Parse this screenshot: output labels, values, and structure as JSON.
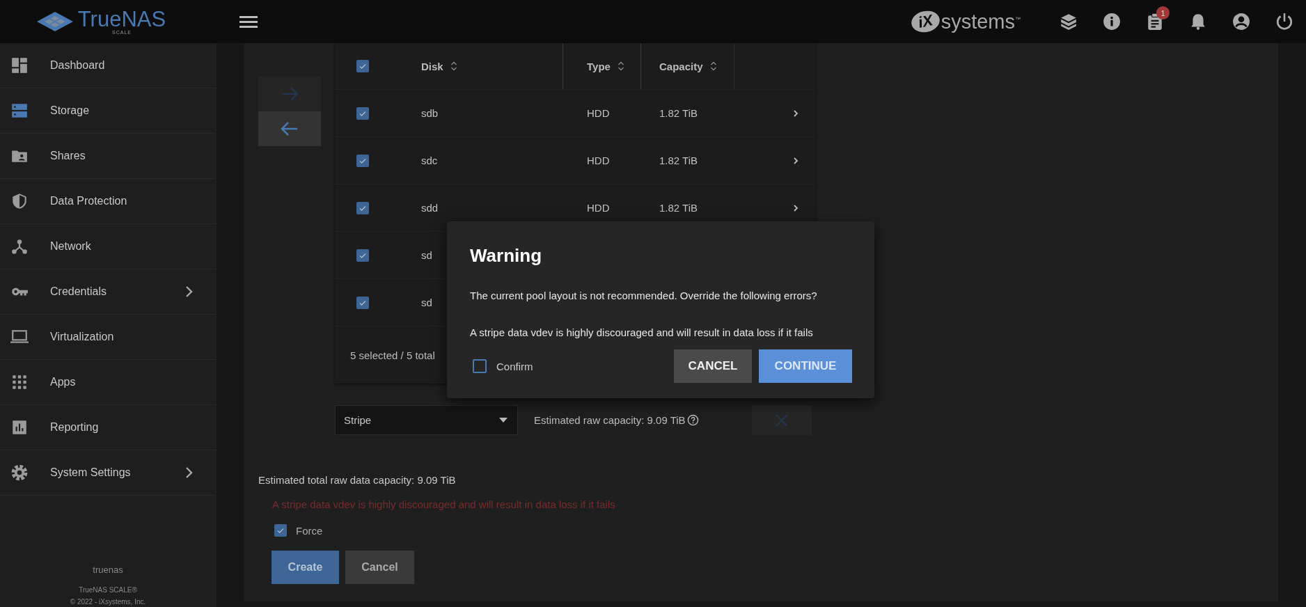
{
  "topbar": {
    "brand": {
      "name": "TrueNAS",
      "edition": "SCALE"
    },
    "vendor": {
      "mark": "iX",
      "name": "systems",
      "trademark": "™"
    },
    "alerts_badge": "1"
  },
  "sidebar": {
    "items": [
      {
        "label": "Dashboard",
        "expandable": false
      },
      {
        "label": "Storage",
        "expandable": false
      },
      {
        "label": "Shares",
        "expandable": false
      },
      {
        "label": "Data Protection",
        "expandable": false
      },
      {
        "label": "Network",
        "expandable": false
      },
      {
        "label": "Credentials",
        "expandable": true
      },
      {
        "label": "Virtualization",
        "expandable": false
      },
      {
        "label": "Apps",
        "expandable": false
      },
      {
        "label": "Reporting",
        "expandable": false
      },
      {
        "label": "System Settings",
        "expandable": true
      }
    ],
    "hostname": "truenas",
    "product": "TrueNAS SCALE®",
    "copyright": "© 2022 - iXsystems, Inc."
  },
  "transfer_buttons": [
    {
      "disabled": true
    },
    {
      "disabled": false
    }
  ],
  "disk_table": {
    "all_checked": true,
    "columns": [
      "Disk",
      "Type",
      "Capacity"
    ],
    "rows": [
      {
        "checked": true,
        "disk": "sdb",
        "type": "HDD",
        "capacity": "1.82 TiB"
      },
      {
        "checked": true,
        "disk": "sdc",
        "type": "HDD",
        "capacity": "1.82 TiB"
      },
      {
        "checked": true,
        "disk": "sdd",
        "type": "HDD",
        "capacity": "1.82 TiB"
      },
      {
        "checked": true,
        "disk": "sd"
      },
      {
        "checked": true,
        "disk": "sd"
      }
    ],
    "footer": "5 selected / 5 total"
  },
  "vdev": {
    "layout": "Stripe",
    "estimate": "Estimated raw capacity: 9.09 TiB",
    "remove_disabled": true
  },
  "total_capacity": "Estimated total raw data capacity: 9.09 TiB",
  "error": "A stripe data vdev is highly discouraged and will result in data loss if it fails",
  "force": {
    "label": "Force",
    "checked": true
  },
  "buttons": [
    {
      "label": "Create",
      "kind": "primary"
    },
    {
      "label": "Cancel",
      "kind": "secondary"
    }
  ],
  "dialog": {
    "title": "Warning",
    "message": "The current pool layout is not recommended. Override the following errors?",
    "detail": "A stripe data vdev is highly discouraged and will result in data loss if it fails",
    "confirm": {
      "label": "Confirm",
      "checked": false
    },
    "buttons": [
      {
        "label": "CANCEL",
        "kind": "secondary",
        "disabled": false
      },
      {
        "label": "CONTINUE",
        "kind": "primary",
        "disabled": true
      }
    ]
  }
}
